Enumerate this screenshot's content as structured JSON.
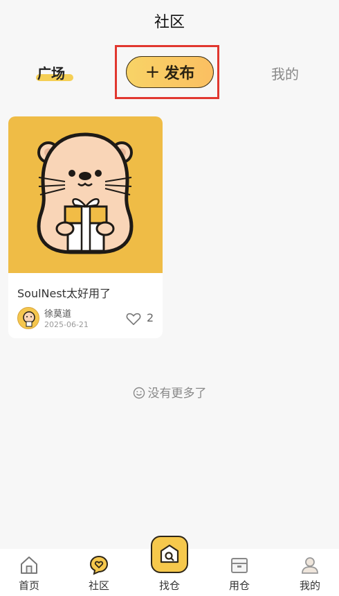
{
  "header": {
    "title": "社区"
  },
  "tabs": {
    "plaza_label": "广场",
    "publish_label": "发布",
    "publish_plus": "+",
    "mine_label": "我的"
  },
  "posts": [
    {
      "title": "SoulNest太好用了",
      "author": "徐莫道",
      "date": "2025-06-21",
      "likes": "2",
      "image_icon": "otter-holding-gift-illustration"
    }
  ],
  "footer_note": "没有更多了",
  "bottom_nav": {
    "items": [
      {
        "label": "首页",
        "icon": "home-icon"
      },
      {
        "label": "社区",
        "icon": "heart-chat-icon"
      },
      {
        "label": "找仓",
        "icon": "find-warehouse-icon"
      },
      {
        "label": "用仓",
        "icon": "box-icon"
      },
      {
        "label": "我的",
        "icon": "profile-icon"
      }
    ]
  },
  "colors": {
    "accent": "#f6c84c",
    "highlight_border": "#e1372f",
    "card_image_bg": "#efbc46",
    "background": "#f7f7f7"
  }
}
